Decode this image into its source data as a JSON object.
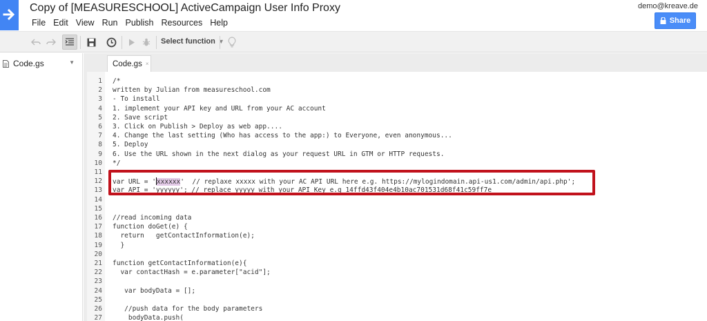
{
  "app": {
    "title": "Copy of [MEASURESCHOOL] ActiveCampaign User Info Proxy",
    "user_email": "demo@kreave.de",
    "share_label": "Share"
  },
  "menu": [
    "File",
    "Edit",
    "View",
    "Run",
    "Publish",
    "Resources",
    "Help"
  ],
  "toolbar": {
    "select_function_label": "Select function"
  },
  "files": [
    {
      "name": "Code.gs"
    }
  ],
  "editor": {
    "active_tab": "Code.gs",
    "lines": [
      {
        "n": "1",
        "text": "/*"
      },
      {
        "n": "2",
        "text": "written by Julian from measureschool.com"
      },
      {
        "n": "3",
        "text": "- To install"
      },
      {
        "n": "4",
        "text": "1. implement your API key and URL from your AC account"
      },
      {
        "n": "5",
        "text": "2. Save script"
      },
      {
        "n": "6",
        "text": "3. Click on Publish > Deploy as web app...."
      },
      {
        "n": "7",
        "text": "4. Change the last setting (Who has access to the app:) to Everyone, even anonymous..."
      },
      {
        "n": "8",
        "text": "5. Deploy"
      },
      {
        "n": "9",
        "text": "6. Use the URL shown in the next dialog as your request URL in GTM or HTTP requests."
      },
      {
        "n": "10",
        "text": "*/"
      },
      {
        "n": "11",
        "text": ""
      },
      {
        "n": "12",
        "text": "var URL = 'xxxxxx'  // replaxe xxxxx with your AC API URL here e.g. https://mylogindomain.api-us1.com/admin/api.php';"
      },
      {
        "n": "13",
        "text": "var API = 'yyyyyy'; // replace yyyyy with your API Key e.g 14ffd43f404e4b10ac701531d68f41c59ff7e"
      },
      {
        "n": "14",
        "text": ""
      },
      {
        "n": "15",
        "text": ""
      },
      {
        "n": "16",
        "text": "//read incoming data"
      },
      {
        "n": "17",
        "text": "function doGet(e) {"
      },
      {
        "n": "18",
        "text": "  return   getContactInformation(e);"
      },
      {
        "n": "19",
        "text": "  }"
      },
      {
        "n": "20",
        "text": ""
      },
      {
        "n": "21",
        "text": "function getContactInformation(e){"
      },
      {
        "n": "22",
        "text": "  var contactHash = e.parameter[\"acid\"];"
      },
      {
        "n": "23",
        "text": ""
      },
      {
        "n": "24",
        "text": "   var bodyData = [];"
      },
      {
        "n": "25",
        "text": ""
      },
      {
        "n": "26",
        "text": "   //push data for the body parameters"
      },
      {
        "n": "27",
        "text": "    bodyData.push("
      }
    ]
  },
  "colors": {
    "accent_blue": "#4285f4",
    "highlight_box": "#c1121c",
    "selection": "#e2c9e6"
  }
}
